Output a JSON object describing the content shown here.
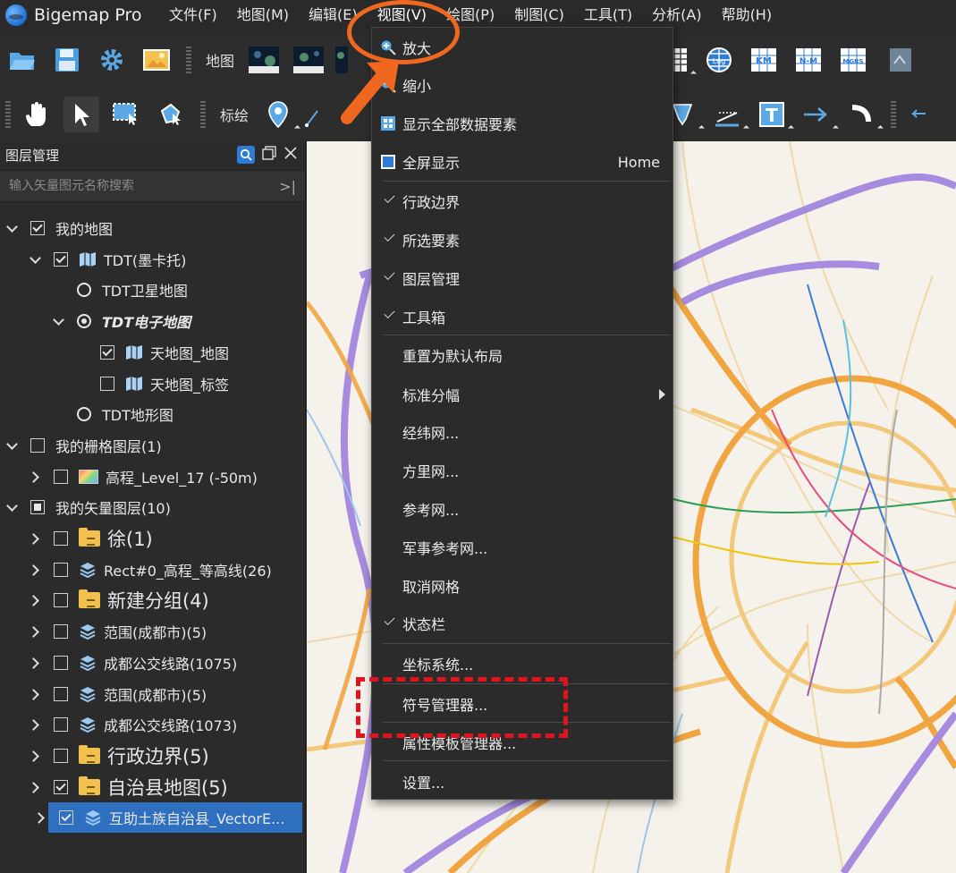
{
  "app": {
    "title": "Bigemap Pro"
  },
  "menubar": [
    "文件(F)",
    "地图(M)",
    "编辑(E)",
    "视图(V)",
    "绘图(P)",
    "制图(C)",
    "工具(T)",
    "分析(A)",
    "帮助(H)"
  ],
  "toolbar1": {
    "map_label": "地图"
  },
  "toolbar2": {
    "draw_label": "标绘"
  },
  "layer_panel": {
    "title": "图层管理",
    "search_placeholder": "输入矢量图元名称搜索",
    "search_go": ">|",
    "rows": [
      {
        "label": "我的地图",
        "expand": "down",
        "indent": 0,
        "check": "checked",
        "icon": "none"
      },
      {
        "label": "TDT(墨卡托)",
        "expand": "down",
        "indent": 1,
        "check": "checked",
        "icon": "map-icon"
      },
      {
        "label": "TDT卫星地图",
        "expand": "none",
        "indent": 2,
        "check": "radio",
        "icon": "none"
      },
      {
        "label": "TDT电子地图",
        "expand": "down",
        "indent": 2,
        "check": "radio-on",
        "icon": "none",
        "style": "bold-italic"
      },
      {
        "label": "天地图_地图",
        "expand": "none",
        "indent": 3,
        "check": "checked",
        "icon": "map-icon"
      },
      {
        "label": "天地图_标签",
        "expand": "none",
        "indent": 3,
        "check": "unchecked",
        "icon": "map-icon"
      },
      {
        "label": "TDT地形图",
        "expand": "none",
        "indent": 2,
        "check": "radio",
        "icon": "none"
      },
      {
        "label": "我的栅格图层(1)",
        "expand": "down",
        "indent": 0,
        "check": "unchecked",
        "icon": "none"
      },
      {
        "label": "高程_Level_17 (-50m)",
        "expand": "right",
        "indent": 1,
        "check": "unchecked",
        "icon": "raster-icon"
      },
      {
        "label": "我的矢量图层(10)",
        "expand": "down",
        "indent": 0,
        "check": "partial",
        "icon": "none"
      },
      {
        "label": "徐(1)",
        "expand": "right",
        "indent": 1,
        "check": "unchecked",
        "icon": "folder-icon",
        "style": "big"
      },
      {
        "label": "Rect#0_高程_等高线(26)",
        "expand": "right",
        "indent": 1,
        "check": "unchecked",
        "icon": "layers-icon"
      },
      {
        "label": "新建分组(4)",
        "expand": "right",
        "indent": 1,
        "check": "unchecked",
        "icon": "folder-icon",
        "style": "big"
      },
      {
        "label": "范围(成都市)(5)",
        "expand": "right",
        "indent": 1,
        "check": "unchecked",
        "icon": "layers-icon"
      },
      {
        "label": "成都公交线路(1075)",
        "expand": "right",
        "indent": 1,
        "check": "unchecked",
        "icon": "layers-icon"
      },
      {
        "label": "范围(成都市)(5)",
        "expand": "right",
        "indent": 1,
        "check": "unchecked",
        "icon": "layers-icon"
      },
      {
        "label": "成都公交线路(1073)",
        "expand": "right",
        "indent": 1,
        "check": "unchecked",
        "icon": "layers-icon"
      },
      {
        "label": "行政边界(5)",
        "expand": "right",
        "indent": 1,
        "check": "unchecked",
        "icon": "folder-icon",
        "style": "big"
      },
      {
        "label": "自治县地图(5)",
        "expand": "right",
        "indent": 1,
        "check": "checked",
        "icon": "folder-icon",
        "style": "big"
      },
      {
        "label": "互助土族自治县_VectorE...",
        "expand": "right",
        "indent": 1,
        "check": "checked",
        "icon": "layers-icon",
        "selected": true
      }
    ]
  },
  "view_menu": {
    "items": [
      {
        "label": "放大",
        "icon": "zoom-in-icon"
      },
      {
        "label": "缩小",
        "icon": "zoom-out-icon"
      },
      {
        "label": "显示全部数据要素",
        "icon": "show-all-icon"
      },
      {
        "label": "全屏显示",
        "icon": "fullscreen-icon",
        "shortcut": "Home"
      },
      {
        "label": "行政边界",
        "checked": true
      },
      {
        "label": "所选要素",
        "checked": true
      },
      {
        "label": "图层管理",
        "checked": true
      },
      {
        "label": "工具箱",
        "checked": true
      },
      {
        "label": "重置为默认布局"
      },
      {
        "label": "标准分幅",
        "submenu": true
      },
      {
        "label": "经纬网..."
      },
      {
        "label": "方里网..."
      },
      {
        "label": "参考网..."
      },
      {
        "label": "军事参考网..."
      },
      {
        "label": "取消网格"
      },
      {
        "label": "状态栏",
        "checked": true
      },
      {
        "label": "坐标系统..."
      },
      {
        "label": "符号管理器...",
        "highlighted": true
      },
      {
        "label": "属性模板管理器..."
      },
      {
        "label": "设置..."
      }
    ]
  },
  "colors": {
    "accent": "#2f7bd8",
    "annotation_orange": "#f0671f",
    "annotation_red": "#e0141e"
  }
}
